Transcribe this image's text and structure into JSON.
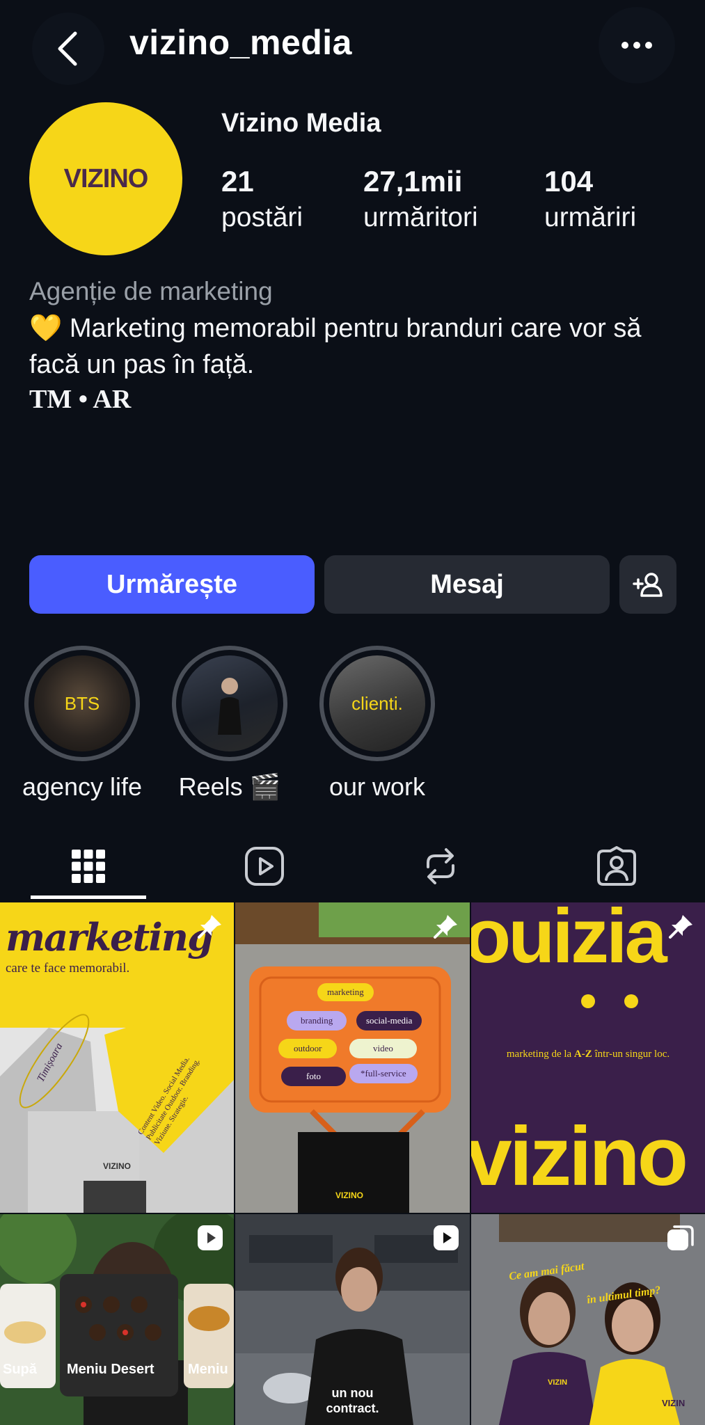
{
  "header": {
    "username": "vizino_media"
  },
  "profile": {
    "avatar_text": "VIZINO",
    "display_name": "Vizino Media",
    "stats": [
      {
        "value": "21",
        "label": "postări"
      },
      {
        "value": "27,1mii",
        "label": "urmăritori"
      },
      {
        "value": "104",
        "label": "urmăriri"
      }
    ],
    "category": "Agenție de marketing",
    "bio_heart": "💛",
    "bio_text": "Marketing memorabil pentru branduri care vor să facă un pas în față.",
    "location": "TM • AR"
  },
  "actions": {
    "follow_label": "Urmărește",
    "message_label": "Mesaj"
  },
  "highlights": [
    {
      "label": "agency life",
      "cover_text": "BTS"
    },
    {
      "label": "Reels 🎬",
      "cover_text": ""
    },
    {
      "label": "our work",
      "cover_text": "clienti."
    }
  ],
  "tabs": [
    "grid-icon",
    "reels-icon",
    "reposts-icon",
    "tagged-icon"
  ],
  "posts": {
    "p1": {
      "headline": "marketing",
      "sub": "care te face memorabil.",
      "city": "Timișoara",
      "services": "Content Video. Social Media. Publicitate Outdoor. Branding. Viziune. Strategie.",
      "building_sign": "VIZINO"
    },
    "p2": {
      "tags": [
        "marketing",
        "branding",
        "social-media",
        "outdoor",
        "video",
        "foto",
        "*full-service"
      ],
      "brand": "VIZINO"
    },
    "p3": {
      "top_word": "ouizia",
      "tagline_pre": "marketing de la ",
      "tagline_bold": "A-Z",
      "tagline_post": " într-un singur loc.",
      "bottom_word": "vizino"
    },
    "p4": {
      "cards": [
        "Supă",
        "Meniu Desert",
        "Meniu"
      ]
    },
    "p5": {
      "caption": "un nou contract."
    },
    "p6": {
      "caption_1": "Ce am mai făcut",
      "caption_2": "în ultimul timp?",
      "shirt_1": "VIZIN",
      "shirt_2": "VIZIN"
    }
  },
  "colors": {
    "background": "#0b0f17",
    "follow_button": "#4a5dff",
    "secondary_button": "#262a33",
    "brand_yellow": "#f6d618",
    "brand_purple": "#3a1f4a"
  }
}
